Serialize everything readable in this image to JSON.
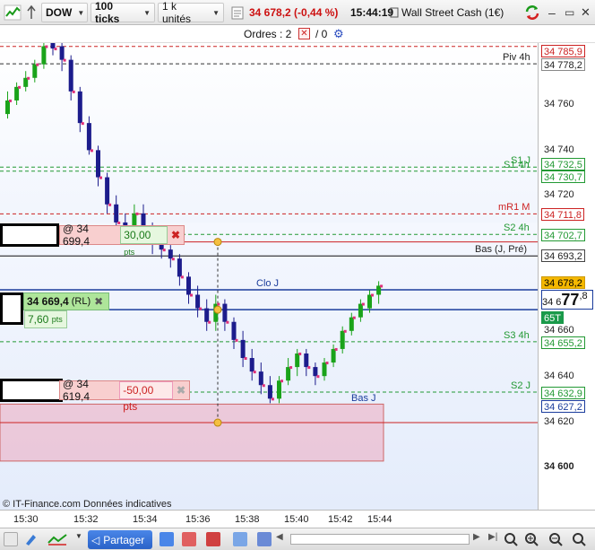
{
  "toolbar": {
    "instrument": "DOW",
    "ticks": "100 ticks",
    "units": "1 k unités",
    "price_change": "34 678,2 (-0,44 %)",
    "time": "15:44:19",
    "instrument_name": "Wall Street Cash (1€)"
  },
  "orders": {
    "label": "Ordres : 2",
    "second": "/ 0"
  },
  "levels": {
    "piv4h": "Piv 4h",
    "s1j": "S1 J",
    "s14h": "S1 4h",
    "mr1m": "mR1 M",
    "s24h": "S2 4h",
    "basjpre": "Bas (J, Pré)",
    "cloj": "Clo J",
    "s34h": "S3 4h",
    "s2j": "S2 J",
    "basj": "Bas J"
  },
  "price_tags": {
    "t1": "34 785,9",
    "t2": "34 778,2",
    "t3": "34 732,5",
    "t4": "34 730,7",
    "t5": "34 711,8",
    "t6": "34 702,7",
    "t7": "34 693,2",
    "t8": "34 678,2",
    "t9_prefix": "34 6",
    "t9_big": "77",
    "t9_suffix": ",8",
    "t10": "65T",
    "t11": "34 655,2",
    "t12": "34 632,9",
    "t13": "34 627,2"
  },
  "price_ticks": {
    "p1": "34 760",
    "p2": "34 740",
    "p3": "34 720",
    "p4": "34 660",
    "p5": "34 640",
    "p6": "34 620",
    "p7": "34 600"
  },
  "order_widgets": {
    "tp": {
      "price": "@ 34 699,4",
      "pts": "30,00",
      "pts_unit": "pts"
    },
    "pos": {
      "price": "34 669,4",
      "tag": "(RL)",
      "pts": "7,60",
      "pts_unit": "pts"
    },
    "sl": {
      "price": "@ 34 619,4",
      "pts": "-50,00 pts"
    }
  },
  "source": "© IT-Finance.com  Données indicatives",
  "time_ticks": [
    "15:30",
    "15:32",
    "15:34",
    "15:36",
    "15:38",
    "15:40",
    "15:42",
    "15:44"
  ],
  "bottombar": {
    "share_label": "Partager"
  },
  "colors": {
    "up": "#1aa31a",
    "down": "#1c1c8c",
    "resistance": "#cc2222",
    "support": "#229933",
    "clo": "#1a3c9c"
  }
}
